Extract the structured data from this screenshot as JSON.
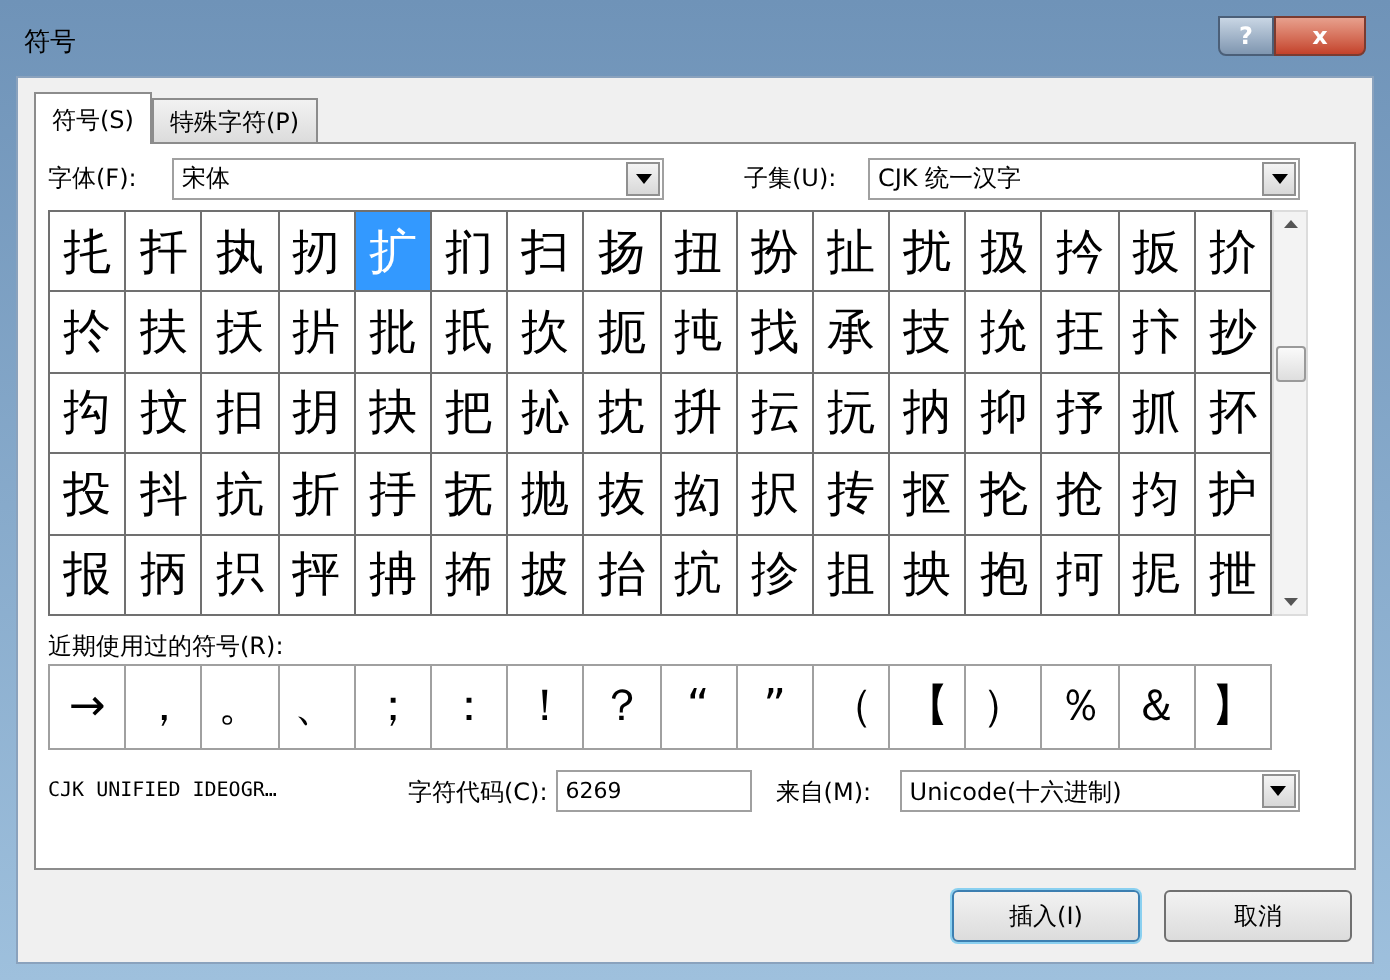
{
  "window": {
    "title": "符号"
  },
  "title_buttons": [
    {
      "kind": "help",
      "label": "?"
    },
    {
      "kind": "close",
      "label": "x"
    }
  ],
  "tabs": [
    {
      "label": "符号(S)",
      "selected": true
    },
    {
      "label": "特殊字符(P)",
      "selected": false
    }
  ],
  "font": {
    "label": "字体(F):",
    "value": "宋体"
  },
  "subset": {
    "label": "子集(U):",
    "value": "CJK 统一汉字"
  },
  "grid": [
    {
      "cells": [
        {
          "char": "扥",
          "selected": false
        },
        {
          "char": "扦",
          "selected": false
        },
        {
          "char": "执",
          "selected": false
        },
        {
          "char": "扨",
          "selected": false
        },
        {
          "char": "扩",
          "selected": true
        },
        {
          "char": "扪",
          "selected": false
        },
        {
          "char": "扫",
          "selected": false
        },
        {
          "char": "扬",
          "selected": false
        },
        {
          "char": "扭",
          "selected": false
        },
        {
          "char": "扮",
          "selected": false
        },
        {
          "char": "扯",
          "selected": false
        },
        {
          "char": "扰",
          "selected": false
        },
        {
          "char": "扱",
          "selected": false
        },
        {
          "char": "扲",
          "selected": false
        },
        {
          "char": "扳",
          "selected": false
        },
        {
          "char": "扴",
          "selected": false
        }
      ]
    },
    {
      "cells": [
        {
          "char": "扵",
          "selected": false
        },
        {
          "char": "扶",
          "selected": false
        },
        {
          "char": "扷",
          "selected": false
        },
        {
          "char": "扸",
          "selected": false
        },
        {
          "char": "批",
          "selected": false
        },
        {
          "char": "扺",
          "selected": false
        },
        {
          "char": "扻",
          "selected": false
        },
        {
          "char": "扼",
          "selected": false
        },
        {
          "char": "扽",
          "selected": false
        },
        {
          "char": "找",
          "selected": false
        },
        {
          "char": "承",
          "selected": false
        },
        {
          "char": "技",
          "selected": false
        },
        {
          "char": "抁",
          "selected": false
        },
        {
          "char": "抂",
          "selected": false
        },
        {
          "char": "抃",
          "selected": false
        },
        {
          "char": "抄",
          "selected": false
        }
      ]
    },
    {
      "cells": [
        {
          "char": "抅",
          "selected": false
        },
        {
          "char": "抆",
          "selected": false
        },
        {
          "char": "抇",
          "selected": false
        },
        {
          "char": "抈",
          "selected": false
        },
        {
          "char": "抉",
          "selected": false
        },
        {
          "char": "把",
          "selected": false
        },
        {
          "char": "抋",
          "selected": false
        },
        {
          "char": "抌",
          "selected": false
        },
        {
          "char": "抍",
          "selected": false
        },
        {
          "char": "抎",
          "selected": false
        },
        {
          "char": "抏",
          "selected": false
        },
        {
          "char": "抐",
          "selected": false
        },
        {
          "char": "抑",
          "selected": false
        },
        {
          "char": "抒",
          "selected": false
        },
        {
          "char": "抓",
          "selected": false
        },
        {
          "char": "抔",
          "selected": false
        }
      ]
    },
    {
      "cells": [
        {
          "char": "投",
          "selected": false
        },
        {
          "char": "抖",
          "selected": false
        },
        {
          "char": "抗",
          "selected": false
        },
        {
          "char": "折",
          "selected": false
        },
        {
          "char": "抙",
          "selected": false
        },
        {
          "char": "抚",
          "selected": false
        },
        {
          "char": "抛",
          "selected": false
        },
        {
          "char": "抜",
          "selected": false
        },
        {
          "char": "抝",
          "selected": false
        },
        {
          "char": "択",
          "selected": false
        },
        {
          "char": "抟",
          "selected": false
        },
        {
          "char": "抠",
          "selected": false
        },
        {
          "char": "抡",
          "selected": false
        },
        {
          "char": "抢",
          "selected": false
        },
        {
          "char": "抣",
          "selected": false
        },
        {
          "char": "护",
          "selected": false
        }
      ]
    },
    {
      "cells": [
        {
          "char": "报",
          "selected": false
        },
        {
          "char": "抦",
          "selected": false
        },
        {
          "char": "抧",
          "selected": false
        },
        {
          "char": "抨",
          "selected": false
        },
        {
          "char": "抩",
          "selected": false
        },
        {
          "char": "抪",
          "selected": false
        },
        {
          "char": "披",
          "selected": false
        },
        {
          "char": "抬",
          "selected": false
        },
        {
          "char": "抭",
          "selected": false
        },
        {
          "char": "抮",
          "selected": false
        },
        {
          "char": "抯",
          "selected": false
        },
        {
          "char": "抰",
          "selected": false
        },
        {
          "char": "抱",
          "selected": false
        },
        {
          "char": "抲",
          "selected": false
        },
        {
          "char": "抳",
          "selected": false
        },
        {
          "char": "抴",
          "selected": false
        }
      ]
    }
  ],
  "recent": {
    "label": "近期使用过的符号(R):",
    "symbols": [
      "→",
      "，",
      "。",
      "、",
      "；",
      "：",
      "！",
      "？",
      "“",
      "”",
      "（",
      "【",
      "）",
      "％",
      "＆",
      "】"
    ]
  },
  "char_name": "CJK UNIFIED IDEOGR…",
  "char_code": {
    "label": "字符代码(C):",
    "value": "6269"
  },
  "from": {
    "label": "来自(M):",
    "value": "Unicode(十六进制)"
  },
  "buttons": [
    {
      "label": "插入(I)",
      "default": true
    },
    {
      "label": "取消",
      "default": false
    }
  ]
}
